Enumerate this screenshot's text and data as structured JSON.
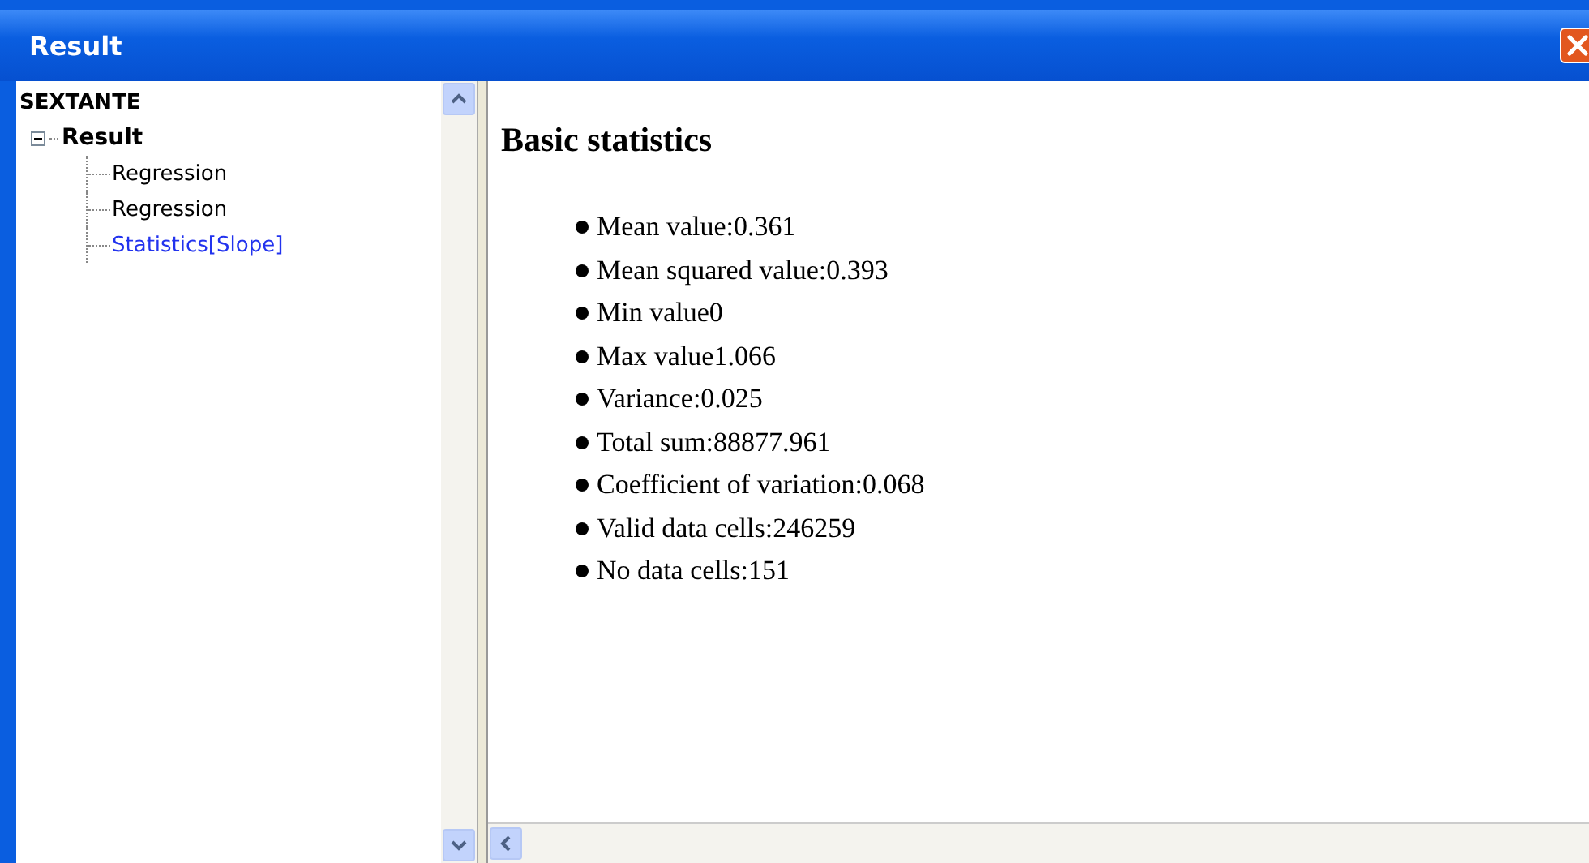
{
  "window": {
    "title": "Result"
  },
  "tree": {
    "label": "SEXTANTE",
    "children": [
      {
        "label": "Result",
        "expanded": true,
        "children": [
          {
            "label": "Regression",
            "selected": false
          },
          {
            "label": "Regression",
            "selected": false
          },
          {
            "label": "Statistics[Slope]",
            "selected": true
          }
        ]
      }
    ]
  },
  "content": {
    "heading": "Basic statistics",
    "items": [
      "Mean value:0.361",
      "Mean squared value:0.393",
      "Min value0",
      "Max value1.066",
      "Variance:0.025",
      "Total sum:88877.961",
      "Coefficient of variation:0.068",
      "Valid data cells:246259",
      "No data cells:151"
    ]
  }
}
